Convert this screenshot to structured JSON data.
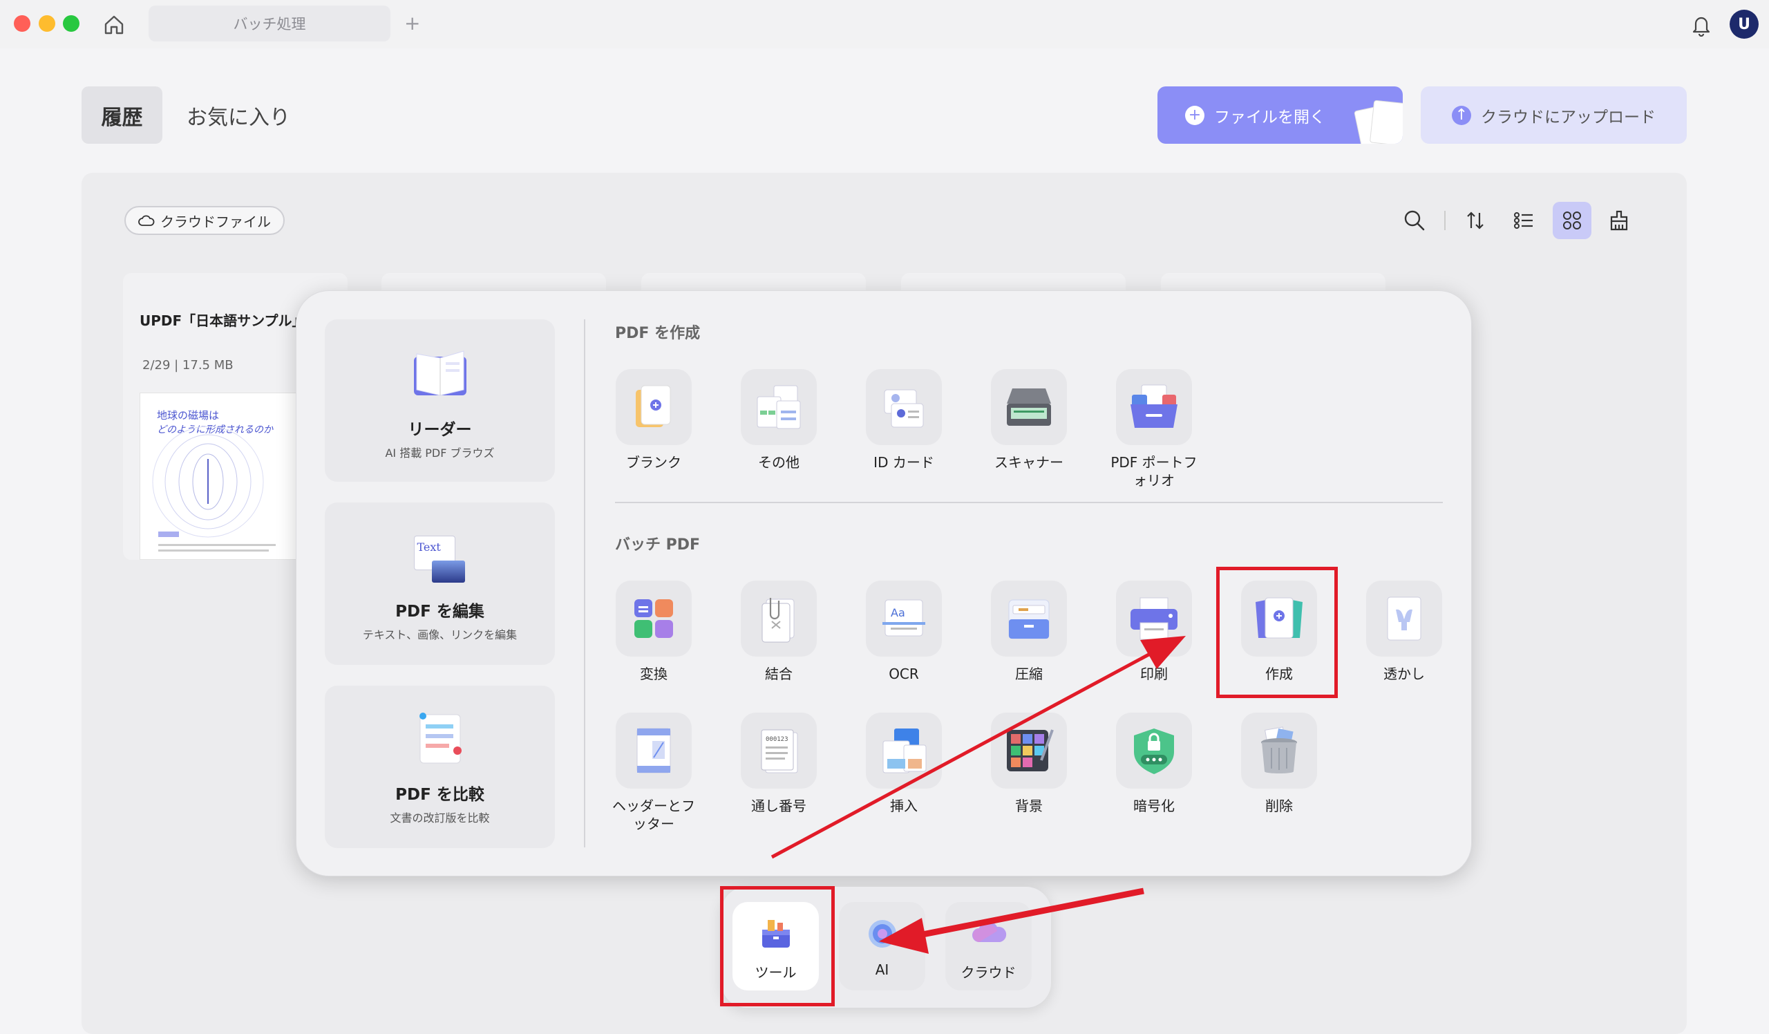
{
  "titlebar": {
    "tab_label": "バッチ処理",
    "add_tab": "+"
  },
  "user": {
    "avatar_letter": "U"
  },
  "header": {
    "history_label": "履歴",
    "favorites_label": "お気に入り",
    "open_file_label": "ファイルを開く",
    "upload_label": "クラウドにアップロード"
  },
  "toolbar": {
    "cloud_files_label": "クラウドファイル"
  },
  "recent_file": {
    "title": "UPDF「日本語サンプル」",
    "meta": "2/29 | 17.5 MB",
    "thumb_title": "地球の磁場は",
    "thumb_subtitle": "どのように形成されるのか"
  },
  "tools_panel": {
    "left_cards": [
      {
        "title": "リーダー",
        "subtitle": "AI 搭載 PDF ブラウズ"
      },
      {
        "title": "PDF を編集",
        "subtitle": "テキスト、画像、リンクを編集",
        "icon_text": "Text"
      },
      {
        "title": "PDF を比較",
        "subtitle": "文書の改訂版を比較"
      }
    ],
    "create_section": {
      "title": "PDF を作成",
      "items": [
        "ブランク",
        "その他",
        "ID カード",
        "スキャナー",
        "PDF ポートフォリオ"
      ]
    },
    "batch_section": {
      "title": "バッチ PDF",
      "items": [
        "変換",
        "結合",
        "OCR",
        "圧縮",
        "印刷",
        "作成",
        "透かし",
        "ヘッダーとフッター",
        "通し番号",
        "挿入",
        "背景",
        "暗号化",
        "削除"
      ]
    }
  },
  "dock": {
    "items": [
      "ツール",
      "AI",
      "クラウド"
    ]
  },
  "colors": {
    "accent": "#8b8ef6",
    "highlight": "#e11b28",
    "panel": "#f1f1f3"
  }
}
